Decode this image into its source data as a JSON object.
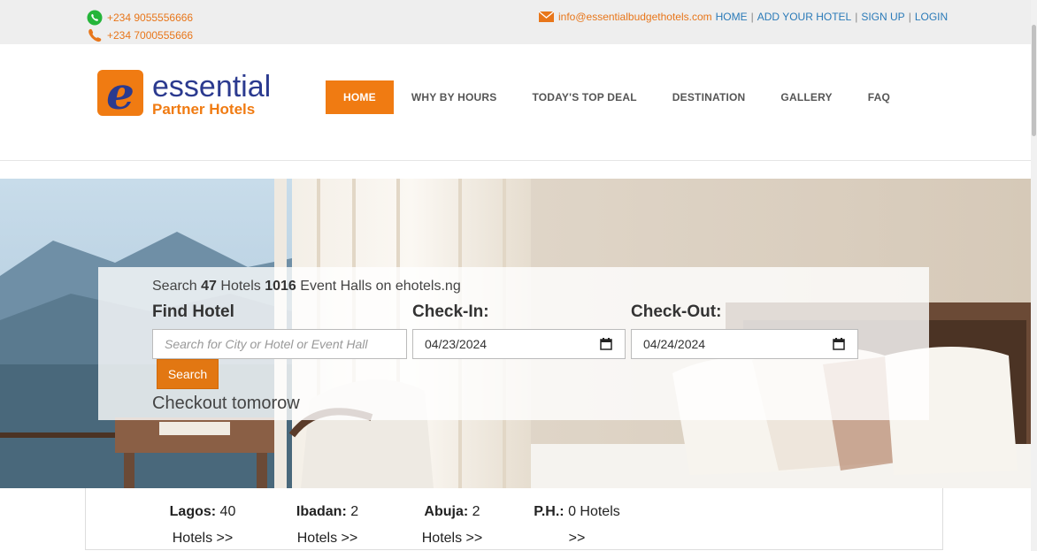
{
  "topbar": {
    "phone_whatsapp": "+234 9055556666",
    "phone_call": "+234 7000555666",
    "email": "info@essentialbudgethotels.com",
    "links": [
      "HOME",
      "ADD YOUR HOTEL",
      "SIGN UP",
      "LOGIN"
    ],
    "separator": "|"
  },
  "logo": {
    "letter": "e",
    "word": "essential",
    "tagline": "Partner Hotels"
  },
  "nav": {
    "items": [
      "HOME",
      "WHY BY HOURS",
      "TODAY'S TOP DEAL",
      "DESTINATION",
      "GALLERY",
      "FAQ"
    ],
    "active": "HOME"
  },
  "search": {
    "intro_prefix": "Search",
    "hotel_count": "47",
    "intro_mid": "Hotels",
    "hall_count": "1016",
    "intro_suffix": "Event Halls on ehotels.ng",
    "find_label": "Find Hotel",
    "checkin_label": "Check-In:",
    "checkout_label": "Check-Out:",
    "find_placeholder": "Search for City or Hotel or Event Hall",
    "checkin_value": "04/23/2024",
    "checkout_value": "04/24/2024",
    "button_label": "Search",
    "checkout_note": "Checkout tomorow"
  },
  "cities": [
    {
      "name": "Lagos:",
      "count": "40",
      "line2": "Hotels >>"
    },
    {
      "name": "Ibadan:",
      "count": "2",
      "line2": "Hotels >>"
    },
    {
      "name": "Abuja:",
      "count": "2",
      "line2": "Hotels >>"
    },
    {
      "name": "P.H.:",
      "count": "0 Hotels",
      "line2": ">>"
    }
  ],
  "colors": {
    "accent": "#f07b12",
    "link": "#2a7ab8",
    "topbar_bg": "#eeeeee",
    "logo_blue": "#2b3a8f"
  }
}
